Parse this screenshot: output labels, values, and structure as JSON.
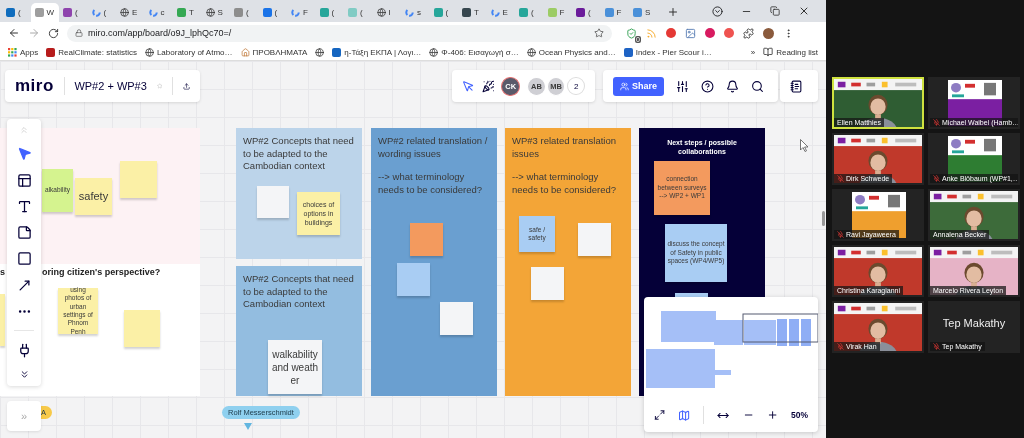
{
  "browser": {
    "tabs": [
      {
        "title": "(",
        "kind": "tile",
        "color": "#0f6cbd",
        "selected": false
      },
      {
        "title": "W",
        "kind": "tile",
        "color": "#9e9e9e",
        "selected": true
      },
      {
        "title": "(",
        "kind": "tile",
        "color": "#8e44ad",
        "selected": false
      },
      {
        "title": "(",
        "kind": "google",
        "selected": false
      },
      {
        "title": "E",
        "kind": "globe",
        "selected": false
      },
      {
        "title": "c",
        "kind": "google",
        "selected": false
      },
      {
        "title": "T",
        "kind": "tile",
        "color": "#34a853",
        "selected": false
      },
      {
        "title": "S",
        "kind": "globe",
        "selected": false
      },
      {
        "title": "(",
        "kind": "tile",
        "color": "#8d8d8d",
        "selected": false
      },
      {
        "title": "(",
        "kind": "tile",
        "color": "#1a73e8",
        "selected": false
      },
      {
        "title": "F",
        "kind": "google",
        "selected": false
      },
      {
        "title": "(",
        "kind": "tile",
        "color": "#26a69a",
        "selected": false
      },
      {
        "title": "(",
        "kind": "tile",
        "color": "#80cbc4",
        "selected": false
      },
      {
        "title": "I",
        "kind": "globe",
        "selected": false
      },
      {
        "title": "s",
        "kind": "google",
        "selected": false
      },
      {
        "title": "(",
        "kind": "tile",
        "color": "#26a69a",
        "selected": false
      },
      {
        "title": "T",
        "kind": "tile",
        "color": "#37474f",
        "selected": false
      },
      {
        "title": "E",
        "kind": "google",
        "selected": false
      },
      {
        "title": "(",
        "kind": "tile",
        "color": "#26a69a",
        "selected": false
      },
      {
        "title": "F",
        "kind": "tile",
        "color": "#9ccc65",
        "selected": false
      },
      {
        "title": "(",
        "kind": "tile",
        "color": "#6a1b9a",
        "selected": false
      },
      {
        "title": "F",
        "kind": "tile",
        "color": "#4a90d9",
        "selected": false
      },
      {
        "title": "S",
        "kind": "tile",
        "color": "#4a90d9",
        "selected": false
      }
    ],
    "url": "miro.com/app/board/o9J_lphQc70=/",
    "extension_badge": "0",
    "bookmarks": [
      {
        "label": "Apps",
        "kind": "apps"
      },
      {
        "label": "RealClimate: statistics",
        "kind": "tile",
        "color": "#b71c1c"
      },
      {
        "label": "Laboratory of Atmo…",
        "kind": "globe"
      },
      {
        "label": "ΠΡΟΒΛΗΜΑΤΑ",
        "kind": "home"
      },
      {
        "kind": "globe"
      },
      {
        "label": "η-Τάξη ΕΚΠΑ | Λογι…",
        "kind": "tile",
        "color": "#1565c0"
      },
      {
        "label": "Φ-406: Εισαγωγή σ…",
        "kind": "globe"
      },
      {
        "label": "Ocean Physics and…",
        "kind": "globe"
      },
      {
        "label": "Index - Pier Scour i…",
        "kind": "tile",
        "color": "#1e63c4"
      }
    ],
    "more_bookmarks": "»",
    "reading_list": "Reading list"
  },
  "board": {
    "logo": "miro",
    "title": "WP#2 + WP#3",
    "starred": false,
    "collaborators": [
      {
        "initials": "CK",
        "kind": "active"
      },
      {
        "initials": "AB",
        "kind": "idle"
      },
      {
        "initials": "MB",
        "kind": "idle"
      }
    ],
    "more_count": "2",
    "share": "Share",
    "tools": [
      {
        "kind": "select",
        "selected": true
      },
      {
        "kind": "frame",
        "selected": false
      },
      {
        "kind": "text",
        "selected": false
      },
      {
        "kind": "sticky",
        "selected": false
      },
      {
        "kind": "shape",
        "selected": false
      },
      {
        "kind": "arrow",
        "selected": false
      },
      {
        "kind": "more",
        "selected": false
      },
      {
        "kind": "plugin",
        "selected": false
      }
    ],
    "frames": [
      {
        "kind": "split",
        "color": "#fdf2f4",
        "heading_parts": [
          "s",
          "oring citizen's perspective?"
        ],
        "stickies": [
          {
            "color": "#d5f38f",
            "text": "alkability"
          },
          {
            "color": "#fbf0a6",
            "text": "safety"
          },
          {
            "color": "#fbf0a6"
          },
          {
            "color": "#fbf0a6"
          },
          {
            "color": "#fbf0a6",
            "text": "using photos of urban settings of Phnom Penh"
          },
          {
            "color": "#fbf0a6"
          }
        ]
      },
      {
        "kind": "column",
        "color": "#bcd4ea",
        "title": "WP#2 Concepts that need to be adapted to the Cambodian context",
        "stickies": [
          {
            "color": "#f4f5f7"
          },
          {
            "color": "#fbf0a6",
            "text": "choices of options in buildings"
          }
        ]
      },
      {
        "kind": "column",
        "color": "#93bde0",
        "title": "WP#2 Concepts that need to be adapted to the Cambodian context",
        "stickies": [
          {
            "color": "#f4f5f7",
            "text": "walkability and weather"
          }
        ]
      },
      {
        "kind": "column",
        "color": "#6a9fd0",
        "title": "WP#2 related translation / wording issues",
        "subtitle": "--> what terminology needs to be considered?",
        "stickies": [
          {
            "color": "#f39a5e"
          },
          {
            "color": "#a9cdf3"
          },
          {
            "color": "#f4f5f7"
          }
        ]
      },
      {
        "kind": "column",
        "color": "#f3a537",
        "title": "WP#3 related translation issues",
        "subtitle": "--> what terminology needs to be considered?",
        "stickies": [
          {
            "color": "#a9cdf3",
            "text": "safe / safety"
          },
          {
            "color": "#f4f5f7"
          },
          {
            "color": "#f4f5f7"
          }
        ]
      },
      {
        "kind": "compact",
        "color": "#050038",
        "title": "Next steps / possible collaborations",
        "stickies": [
          {
            "color": "#f39a5e",
            "text": "connection between surveys --> WP2 + WP1"
          },
          {
            "color": "#a9cdf3",
            "text": "discuss the concept of Safety in public spaces (WP4/WP5)"
          },
          {
            "color": "#a9cdf3"
          }
        ]
      }
    ],
    "cursor_labels": [
      {
        "name": "A",
        "color": "#f7c948"
      },
      {
        "name": "Rolf Messerschmidt",
        "color": "#8fd0ef"
      }
    ],
    "expand": "»",
    "minimap_open": true,
    "zoom": "50%"
  },
  "meeting": {
    "participants": [
      {
        "name": "Ellen Matthies",
        "kind": "camera",
        "color": "#2f5d33",
        "muted": false,
        "speaking": true
      },
      {
        "name": "Michael Waibel (Hamb…",
        "kind": "slide",
        "color": "#7b1fa2",
        "muted": true,
        "speaking": false
      },
      {
        "name": "Dirk Schwede",
        "kind": "camera",
        "color": "#c0392b",
        "muted": true,
        "speaking": false
      },
      {
        "name": "Anke Blöbaum (WP#1,…",
        "kind": "slide",
        "color": "#2e7d32",
        "muted": true,
        "speaking": false
      },
      {
        "name": "Ravi Jayaweera",
        "kind": "slide",
        "color": "#ef9f2e",
        "muted": true,
        "speaking": false
      },
      {
        "name": "Annalena Becker",
        "kind": "camera",
        "color": "#3d6b3a",
        "muted": false,
        "speaking": false
      },
      {
        "name": "Christina Karagianni",
        "kind": "camera",
        "color": "#c0392b",
        "muted": false,
        "speaking": false
      },
      {
        "name": "Marcelo Rivera Leyton",
        "kind": "camera",
        "color": "#e6b3c6",
        "muted": false,
        "speaking": false
      },
      {
        "name": "Virak Han",
        "kind": "camera",
        "color": "#c0392b",
        "muted": true,
        "speaking": false
      },
      {
        "name": "Tep Makathy",
        "kind": "off",
        "display_name": "Tep Makathy",
        "muted": true,
        "speaking": false
      }
    ]
  }
}
